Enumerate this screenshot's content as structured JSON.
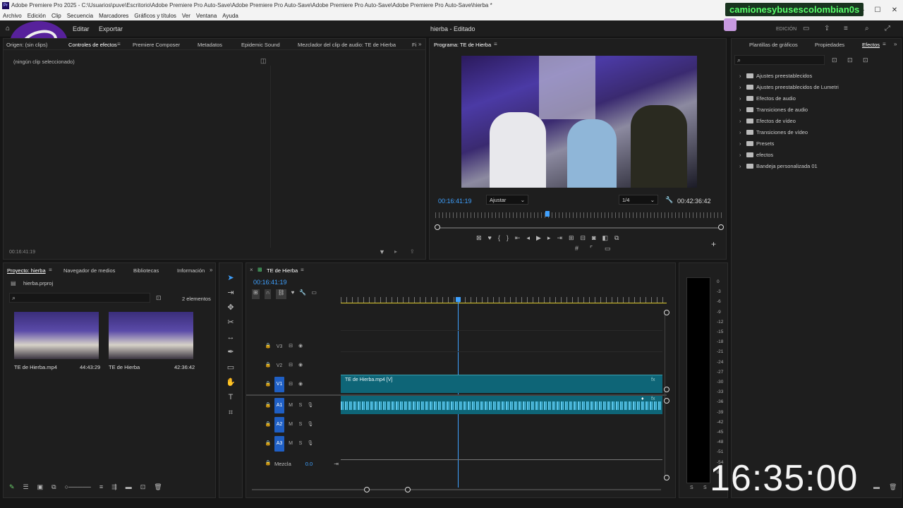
{
  "window": {
    "title": "Adobe Premiere Pro 2025 - C:\\Usuarios\\puve\\Escritorio\\Adobe Premiere Pro Auto-Save\\Adobe Premiere Pro Auto-Save\\Adobe Premiere Pro Auto-Save\\Adobe Premiere Pro Auto-Save\\hierba *",
    "app_icon": "Pr",
    "controls": [
      "—",
      "☐",
      "✕"
    ]
  },
  "menu": [
    "Archivo",
    "Edición",
    "Clip",
    "Secuencia",
    "Marcadores",
    "Gráficos y títulos",
    "Ver",
    "Ventana",
    "Ayuda"
  ],
  "topbar": {
    "tabs": [
      "Editar",
      "Exportar"
    ],
    "project_title": "hierba - Editado",
    "mode": "EDICIÓN"
  },
  "watermark": "camionesybusescolombian0s",
  "clock": "16:35:00",
  "source_panel": {
    "tabs": [
      "Origen: (sin clips)",
      "Controles de efectos",
      "Premiere Composer",
      "Metadatos",
      "Epidemic Sound",
      "Mezclador del clip de audio: TE de Hierba",
      "Fi"
    ],
    "placeholder": "(ningún clip seleccionado)",
    "timecode": "00:16:41:19"
  },
  "program_panel": {
    "title": "Programa: TE de Hierba",
    "timecode": "00:16:41:19",
    "fit": "Ajustar",
    "resolution": "1/4",
    "duration": "00:42:36:42",
    "playhead_fraction": 0.39
  },
  "right_panel": {
    "tabs": [
      "Plantillas de gráficos",
      "Propiedades",
      "Efectos"
    ],
    "folders": [
      "Ajustes preestablecidos",
      "Ajustes preestablecidos de Lumetri",
      "Efectos de audio",
      "Transiciones de audio",
      "Efectos de vídeo",
      "Transiciones de vídeo",
      "Presets",
      "efectos",
      "Bandeja personalizada 01"
    ]
  },
  "project_panel": {
    "tabs": [
      "Proyecto: hierba",
      "Navegador de medios",
      "Bibliotecas",
      "Información"
    ],
    "file": "hierba.prproj",
    "count": "2 elementos",
    "items": [
      {
        "name": "TE de Hierba.mp4",
        "duration": "44:43:29"
      },
      {
        "name": "TE de Hierba",
        "duration": "42:36:42"
      }
    ]
  },
  "timeline": {
    "title": "TE de Hierba",
    "timecode": "00:16:41:19",
    "video_tracks": [
      "V3",
      "V2",
      "V1"
    ],
    "audio_tracks": [
      "A1",
      "A2",
      "A3"
    ],
    "clip_label": "TE de Hierba.mp4 [V]",
    "mix_label": "Mezcla",
    "mix_value": "0.0",
    "playhead_fraction": 0.36
  },
  "meter": {
    "labels": [
      "0",
      "-3",
      "-6",
      "-9",
      "-12",
      "-15",
      "-18",
      "-21",
      "-24",
      "-27",
      "-30",
      "-33",
      "-36",
      "-39",
      "-42",
      "-45",
      "-48",
      "-51",
      "-54",
      "dB"
    ],
    "solo": [
      "S",
      "S"
    ]
  },
  "colors": {
    "accent": "#3fa1ff",
    "track_label": "#1f5fc4",
    "clip": "#0e6577",
    "audio_clip": "#0e6577",
    "watermark_text": "#58ff6a"
  }
}
